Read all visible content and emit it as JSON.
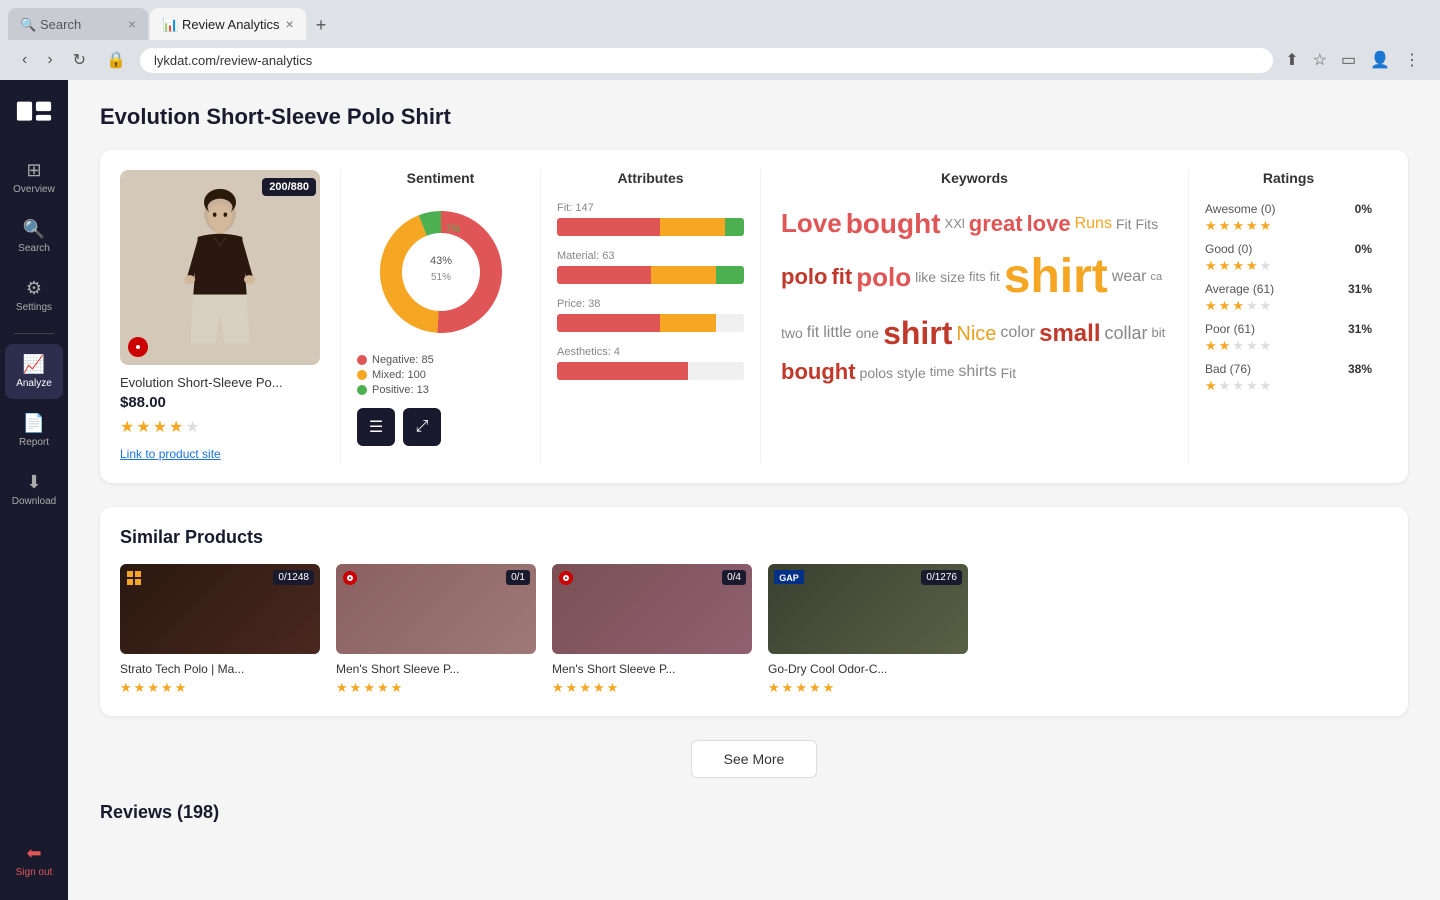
{
  "browser": {
    "tabs": [
      {
        "id": "search",
        "title": "Search",
        "active": false,
        "icon": "🔍"
      },
      {
        "id": "review_analytics",
        "title": "Review Analytics",
        "active": true,
        "icon": "📊"
      }
    ],
    "address": "lykdat.com/review-analytics",
    "new_tab_label": "+"
  },
  "sidebar": {
    "logo_alt": "Lykdat",
    "items": [
      {
        "id": "overview",
        "label": "Overview",
        "icon": "⊞",
        "active": false
      },
      {
        "id": "search",
        "label": "Search",
        "icon": "🔍",
        "active": false
      },
      {
        "id": "settings",
        "label": "Settings",
        "icon": "⚙",
        "active": false
      },
      {
        "id": "analyze",
        "label": "Analyze",
        "icon": "📈",
        "active": true
      },
      {
        "id": "report",
        "label": "Report",
        "icon": "📄",
        "active": false
      },
      {
        "id": "download",
        "label": "Download",
        "icon": "⬇",
        "active": false
      }
    ],
    "sign_out_label": "Sign out",
    "sign_out_icon": "⬅"
  },
  "product": {
    "title": "Evolution Short-Sleeve Polo Shirt",
    "name": "Evolution Short-Sleeve Po...",
    "price": "$88.00",
    "badge": "200/880",
    "link_text": "Link to product site",
    "stars": 4,
    "max_stars": 5
  },
  "sentiment": {
    "title": "Sentiment",
    "donut": {
      "negative_pct": 51,
      "mixed_pct": 43,
      "positive_pct": 7,
      "negative_color": "#e05555",
      "mixed_color": "#f5a623",
      "positive_color": "#4caf50"
    },
    "legend": [
      {
        "label": "Negative:",
        "value": 85,
        "color": "#e05555"
      },
      {
        "label": "Mixed:",
        "value": 100,
        "color": "#f5a623"
      },
      {
        "label": "Positive:",
        "value": 13,
        "color": "#4caf50"
      }
    ],
    "filter_btn_label": "≡",
    "expand_btn_label": "⤢"
  },
  "attributes": {
    "title": "Attributes",
    "items": [
      {
        "label": "Fit: 147",
        "red_pct": 55,
        "orange_pct": 35,
        "green_pct": 10
      },
      {
        "label": "Material: 63",
        "red_pct": 50,
        "orange_pct": 35,
        "green_pct": 15
      },
      {
        "label": "Price: 38",
        "red_pct": 55,
        "orange_pct": 30,
        "green_pct": 0
      },
      {
        "label": "Aesthetics: 4",
        "red_pct": 70,
        "orange_pct": 0,
        "green_pct": 0
      }
    ]
  },
  "keywords": {
    "title": "Keywords",
    "words": [
      {
        "text": "Love",
        "size": 26,
        "color": "#e05555"
      },
      {
        "text": "bought",
        "size": 28,
        "color": "#e05555"
      },
      {
        "text": "XXl",
        "size": 13,
        "color": "#888"
      },
      {
        "text": "great",
        "size": 22,
        "color": "#e05555"
      },
      {
        "text": "love",
        "size": 22,
        "color": "#e05555"
      },
      {
        "text": "Runs",
        "size": 16,
        "color": "#f5a623"
      },
      {
        "text": "Fit",
        "size": 14,
        "color": "#888"
      },
      {
        "text": "Fits",
        "size": 14,
        "color": "#888"
      },
      {
        "text": "polo",
        "size": 22,
        "color": "#c0392b"
      },
      {
        "text": "fit",
        "size": 22,
        "color": "#c0392b"
      },
      {
        "text": "polo",
        "size": 26,
        "color": "#e05555"
      },
      {
        "text": "like",
        "size": 14,
        "color": "#888"
      },
      {
        "text": "size",
        "size": 14,
        "color": "#888"
      },
      {
        "text": "fits",
        "size": 13,
        "color": "#888"
      },
      {
        "text": "fit",
        "size": 13,
        "color": "#888"
      },
      {
        "text": "shirt",
        "size": 48,
        "color": "#f5a623"
      },
      {
        "text": "wear",
        "size": 16,
        "color": "#888"
      },
      {
        "text": "ca",
        "size": 11,
        "color": "#888"
      },
      {
        "text": "two",
        "size": 14,
        "color": "#888"
      },
      {
        "text": "fit",
        "size": 16,
        "color": "#888"
      },
      {
        "text": "little",
        "size": 16,
        "color": "#888"
      },
      {
        "text": "one",
        "size": 14,
        "color": "#888"
      },
      {
        "text": "shirt",
        "size": 32,
        "color": "#c0392b"
      },
      {
        "text": "Nice",
        "size": 20,
        "color": "#e8a020"
      },
      {
        "text": "color",
        "size": 16,
        "color": "#888"
      },
      {
        "text": "small",
        "size": 24,
        "color": "#c0392b"
      },
      {
        "text": "collar",
        "size": 18,
        "color": "#888"
      },
      {
        "text": "bit",
        "size": 13,
        "color": "#888"
      },
      {
        "text": "bought",
        "size": 22,
        "color": "#c0392b"
      },
      {
        "text": "polos",
        "size": 14,
        "color": "#888"
      },
      {
        "text": "style",
        "size": 14,
        "color": "#888"
      },
      {
        "text": "time",
        "size": 13,
        "color": "#888"
      },
      {
        "text": "shirts",
        "size": 16,
        "color": "#888"
      },
      {
        "text": "Fit",
        "size": 14,
        "color": "#888"
      }
    ]
  },
  "ratings": {
    "title": "Ratings",
    "items": [
      {
        "label": "Awesome (0)",
        "pct_text": "0%",
        "stars": 5,
        "pct": 0
      },
      {
        "label": "Good (0)",
        "pct_text": "0%",
        "stars": 4,
        "pct": 0
      },
      {
        "label": "Average (61)",
        "pct_text": "31%",
        "stars": 3,
        "pct": 31
      },
      {
        "label": "Poor (61)",
        "pct_text": "31%",
        "stars": 2,
        "pct": 31
      },
      {
        "label": "Bad (76)",
        "pct_text": "38%",
        "stars": 1,
        "pct": 38
      }
    ]
  },
  "similar_products": {
    "title": "Similar Products",
    "items": [
      {
        "name": "Strato Tech Polo | Ma...",
        "badge": "0/1248",
        "stars": 4.5,
        "img_style": "dark",
        "has_logo": true,
        "logo_type": "grid"
      },
      {
        "name": "Men's Short Sleeve P...",
        "badge": "0/1",
        "stars": 5,
        "img_style": "mauve",
        "has_logo": true,
        "logo_type": "target"
      },
      {
        "name": "Men's Short Sleeve P...",
        "badge": "0/4",
        "stars": 4.5,
        "img_style": "mauve2",
        "has_logo": true,
        "logo_type": "target"
      },
      {
        "name": "Go-Dry Cool Odor-C...",
        "badge": "0/1276",
        "stars": 4.5,
        "img_style": "olive",
        "has_logo": true,
        "logo_type": "gap"
      }
    ],
    "see_more_label": "See More"
  },
  "reviews": {
    "title_label": "Reviews (198)"
  }
}
